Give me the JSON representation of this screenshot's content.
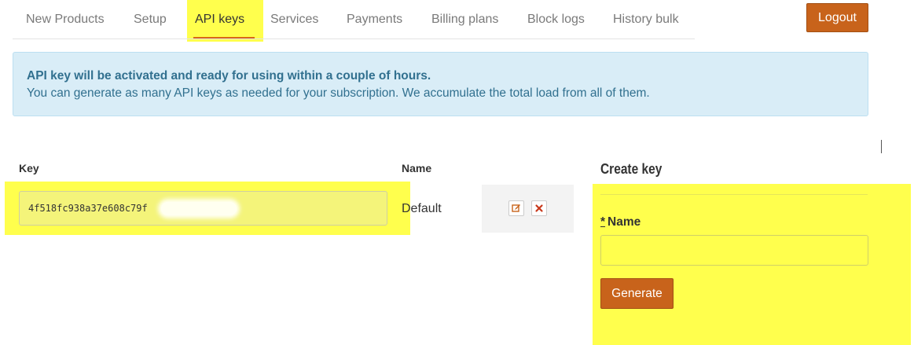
{
  "nav": {
    "tabs": [
      {
        "label": "New Products"
      },
      {
        "label": "Setup"
      },
      {
        "label": "API keys",
        "active": true
      },
      {
        "label": "Services"
      },
      {
        "label": "Payments"
      },
      {
        "label": "Billing plans"
      },
      {
        "label": "Block logs"
      },
      {
        "label": "History bulk"
      }
    ],
    "logout_label": "Logout"
  },
  "alert": {
    "title": "API key will be activated and ready for using within a couple of hours.",
    "message": "You can generate as many API keys as needed for your subscription. We accumulate the total load from all of them."
  },
  "keys_table": {
    "headers": {
      "key": "Key",
      "name": "Name"
    },
    "rows": [
      {
        "key": "4f518fc938a37e608c79f",
        "name": "Default"
      }
    ]
  },
  "create_key": {
    "title": "Create key",
    "required_mark": "*",
    "name_label": "Name",
    "name_value": "",
    "generate_label": "Generate"
  },
  "icons": [
    "edit-icon",
    "delete-icon"
  ],
  "colors": {
    "accent": "#c8631b",
    "alert_bg": "#d9edf7",
    "alert_text": "#31708f",
    "highlight": "#ffff4d"
  }
}
